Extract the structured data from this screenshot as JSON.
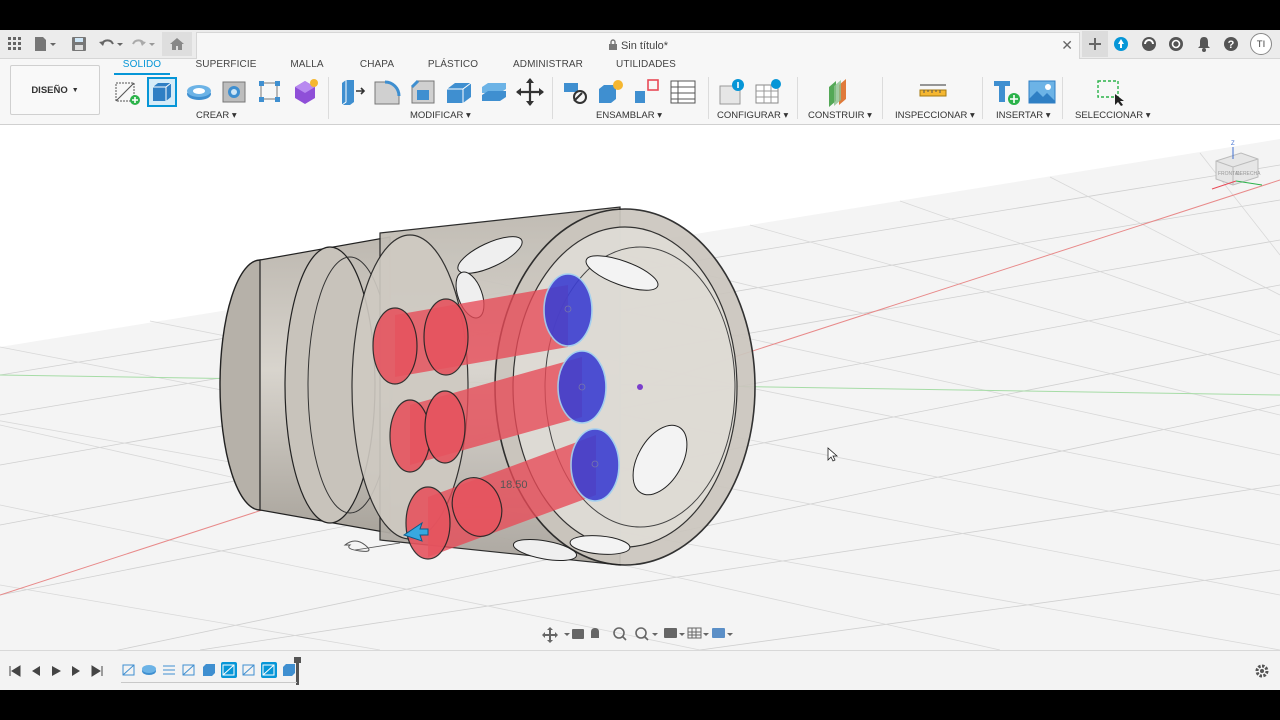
{
  "document": {
    "title": "Sin título*"
  },
  "workspace": {
    "label": "DISEÑO"
  },
  "tabs": [
    {
      "label": "SOLIDO",
      "active": true
    },
    {
      "label": "SUPERFICIE"
    },
    {
      "label": "MALLA"
    },
    {
      "label": "CHAPA"
    },
    {
      "label": "PLÁSTICO"
    },
    {
      "label": "ADMINISTRAR"
    },
    {
      "label": "UTILIDADES"
    }
  ],
  "groups": {
    "crear": "CREAR",
    "modificar": "MODIFICAR",
    "ensamblar": "ENSAMBLAR",
    "configurar": "CONFIGURAR",
    "construir": "CONSTRUIR",
    "inspeccionar": "INSPECCIONAR",
    "insertar": "INSERTAR",
    "seleccionar": "SELECCIONAR"
  },
  "viewcube": {
    "labels": [
      "FRONTAL",
      "DERECHA"
    ],
    "axis": "Z"
  },
  "viewport": {
    "dimension": "18.50"
  },
  "user": {
    "initials": "TI"
  },
  "colors": {
    "accent": "#0696d7",
    "profile_red": "#e84a57",
    "selected_blue": "#3d3fd1"
  }
}
